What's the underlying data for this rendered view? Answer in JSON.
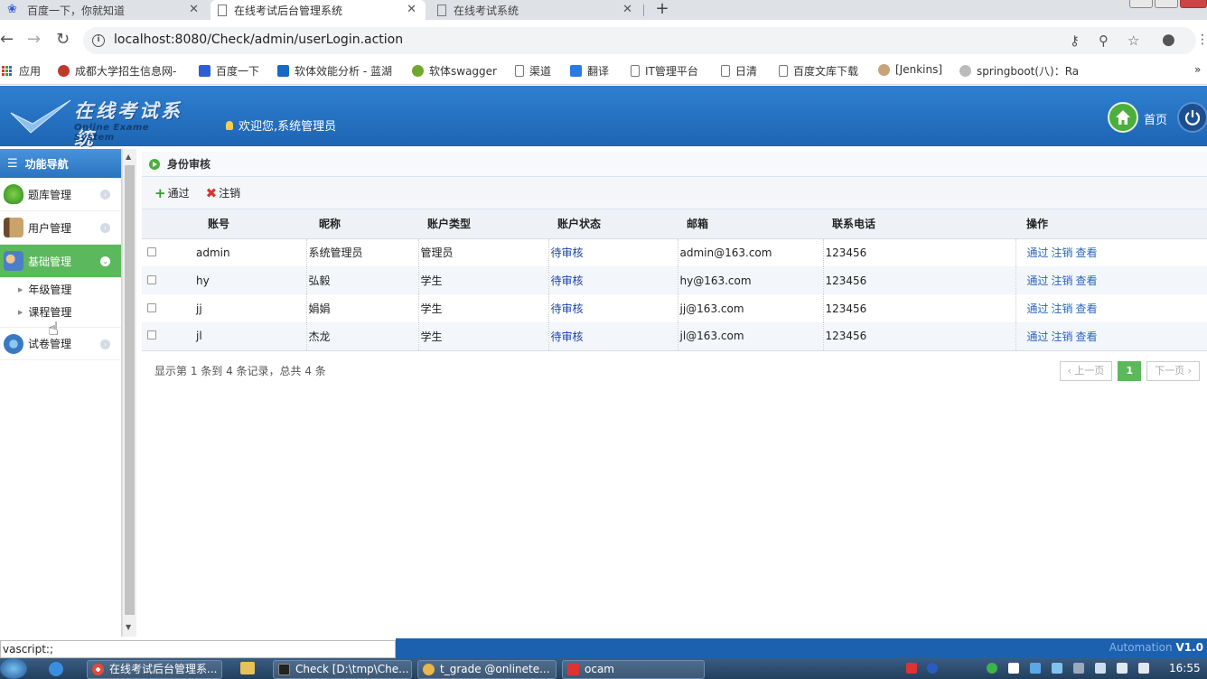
{
  "browser": {
    "tabs": [
      {
        "title": "百度一下，你就知道",
        "active": false
      },
      {
        "title": "在线考试后台管理系统",
        "active": true
      },
      {
        "title": "在线考试系统",
        "active": false
      }
    ],
    "url": "localhost:8080/Check/admin/userLogin.action",
    "bookmarks": [
      {
        "label": "应用"
      },
      {
        "label": "成都大学招生信息网-"
      },
      {
        "label": "百度一下"
      },
      {
        "label": "软体效能分析 - 蓝湖"
      },
      {
        "label": "软体swagger"
      },
      {
        "label": "渠道"
      },
      {
        "label": "翻译"
      },
      {
        "label": "IT管理平台"
      },
      {
        "label": "日清"
      },
      {
        "label": "百度文库下载"
      },
      {
        "label": "[Jenkins]"
      },
      {
        "label": "springboot(八)：Ra"
      }
    ]
  },
  "header": {
    "logo_title": "在线考试系统",
    "logo_subtitle": "Online Exame System",
    "welcome": "欢迎您,系统管理员",
    "home_label": "首页"
  },
  "sidebar": {
    "title": "功能导航",
    "menus": [
      {
        "label": "题库管理"
      },
      {
        "label": "用户管理"
      },
      {
        "label": "基础管理",
        "active": true,
        "children": [
          "年级管理",
          "课程管理"
        ]
      },
      {
        "label": "试卷管理"
      }
    ]
  },
  "panel": {
    "title": "身份审核",
    "toolbar": {
      "pass": "通过",
      "cancel": "注销"
    },
    "columns": [
      "账号",
      "昵称",
      "账户类型",
      "账户状态",
      "邮箱",
      "联系电话",
      "操作"
    ],
    "rows": [
      {
        "account": "admin",
        "nickname": "系统管理员",
        "type": "管理员",
        "status": "待审核",
        "email": "admin@163.com",
        "phone": "123456"
      },
      {
        "account": "hy",
        "nickname": "弘毅",
        "type": "学生",
        "status": "待审核",
        "email": "hy@163.com",
        "phone": "123456"
      },
      {
        "account": "jj",
        "nickname": "娟娟",
        "type": "学生",
        "status": "待审核",
        "email": "jj@163.com",
        "phone": "123456"
      },
      {
        "account": "jl",
        "nickname": "杰龙",
        "type": "学生",
        "status": "待审核",
        "email": "jl@163.com",
        "phone": "123456"
      }
    ],
    "row_actions": [
      "通过",
      "注销",
      "查看"
    ],
    "pager": {
      "info": "显示第 1 条到 4 条记录，总共 4 条",
      "prev": "‹ 上一页",
      "current": "1",
      "next": "下一页 ›"
    }
  },
  "status_bar": {
    "url": "vascript:;"
  },
  "footer": {
    "brand": "Automation",
    "version": "V1.0"
  },
  "taskbar": {
    "items": [
      "在线考试后台管理系...",
      "Check [D:\\tmp\\Che...",
      "t_grade @onlinete...",
      "ocam"
    ],
    "clock": "16:55"
  },
  "colors": {
    "accent": "#2f7fd0",
    "active_menu": "#5cb85c",
    "status_link": "#1a3fb0"
  }
}
